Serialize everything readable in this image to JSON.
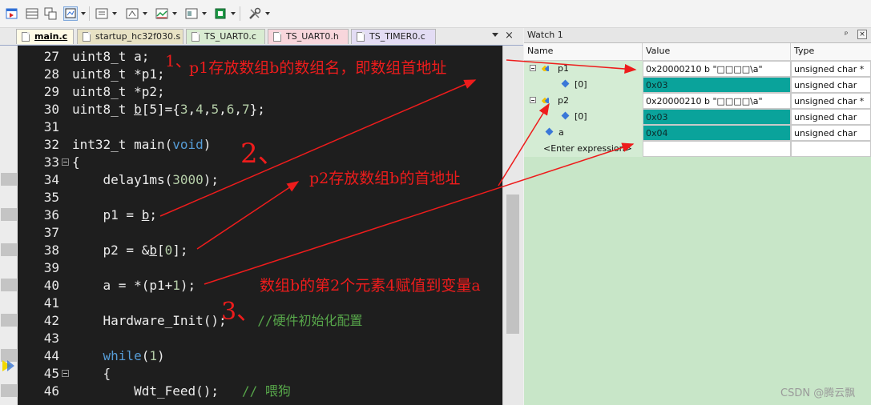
{
  "toolbar": {
    "icons": [
      "run-icon",
      "window-icon",
      "view-icon",
      "select-icon",
      "menu-icon",
      "debug-icon",
      "analyzer-icon",
      "layout-icon",
      "chip-icon",
      "tools-icon"
    ],
    "colors": {
      "accent_green": "#1e9a46",
      "accent_blue": "#2f6fd6"
    }
  },
  "tabs": [
    {
      "label": "main.c",
      "active": true,
      "color": "#fffbe6"
    },
    {
      "label": "startup_hc32f030.s",
      "color": "#e8e2c4"
    },
    {
      "label": "TS_UART0.c",
      "color": "#d9ecd2"
    },
    {
      "label": "TS_UART0.h",
      "color": "#f8d6dc"
    },
    {
      "label": "TS_TIMER0.c",
      "color": "#e3dcf4"
    }
  ],
  "tab_close": "×",
  "editor": {
    "lines": [
      "27",
      "28",
      "29",
      "30",
      "31",
      "32",
      "33",
      "34",
      "35",
      "36",
      "37",
      "38",
      "39",
      "40",
      "41",
      "42",
      "43",
      "44",
      "45",
      "46"
    ],
    "code": {
      "l27": "uint8_t a;",
      "l28": "uint8_t *p1;",
      "l29": "uint8_t *p2;",
      "l30_a": "uint8_t ",
      "l30_b": "b",
      "l30_c": "[5]={",
      "l30_d": "3",
      "l30_e": ",",
      "l30_f": "4",
      "l30_g": ",",
      "l30_h": "5",
      "l30_i": ",",
      "l30_j": "6",
      "l30_k": ",",
      "l30_l": "7",
      "l30_m": "};",
      "l32_a": "int32_t main(",
      "l32_b": "void",
      "l32_c": ")",
      "l33": "{",
      "l34_a": "    delay1ms(",
      "l34_b": "3000",
      "l34_c": ");",
      "l36_a": "    p1 = ",
      "l36_b": "b",
      "l36_c": ";",
      "l38_a": "    p2 = &",
      "l38_b": "b",
      "l38_c": "[",
      "l38_d": "0",
      "l38_e": "];",
      "l40_a": "    a = *(p1+",
      "l40_b": "1",
      "l40_c": ");",
      "l42_a": "    Hardware_Init();",
      "l42_b": "    //硬件初始化配置",
      "l44_a": "    ",
      "l44_b": "while",
      "l44_c": "(",
      "l44_d": "1",
      "l44_e": ")",
      "l45": "    {",
      "l46_a": "        Wdt_Feed();",
      "l46_b": "   // 喂狗"
    },
    "colors": {
      "background": "#1e1e1e",
      "keyword": "#569cd6",
      "number": "#b5cea8",
      "comment": "#57a64a"
    }
  },
  "watch": {
    "title": "Watch 1",
    "pin": "ᵖ",
    "close": "×",
    "columns": [
      "Name",
      "Value",
      "Type"
    ],
    "rows": [
      {
        "name": "p1",
        "value": "0x20000210 b \"□□□□\\a\"",
        "type": "unsigned char *"
      },
      {
        "name": "[0]",
        "value": "0x03",
        "type": "unsigned char"
      },
      {
        "name": "p2",
        "value": "0x20000210 b \"□□□□\\a\"",
        "type": "unsigned char *"
      },
      {
        "name": "[0]",
        "value": "0x03",
        "type": "unsigned char"
      },
      {
        "name": "a",
        "value": "0x04",
        "type": "unsigned char"
      },
      {
        "name": "<Enter expression>",
        "value": "",
        "type": ""
      }
    ],
    "highlight_color": "#0aa39b"
  },
  "annotations": {
    "n1": "1、",
    "t1": "p1存放数组b的数组名，即数组首地址",
    "n2": "2、",
    "t2": "p2存放数组b的首地址",
    "n3": "3、",
    "t3": "数组b的第2个元素4赋值到变量a",
    "color": "#ee1c1c"
  },
  "watermark": "CSDN @腾云飘"
}
